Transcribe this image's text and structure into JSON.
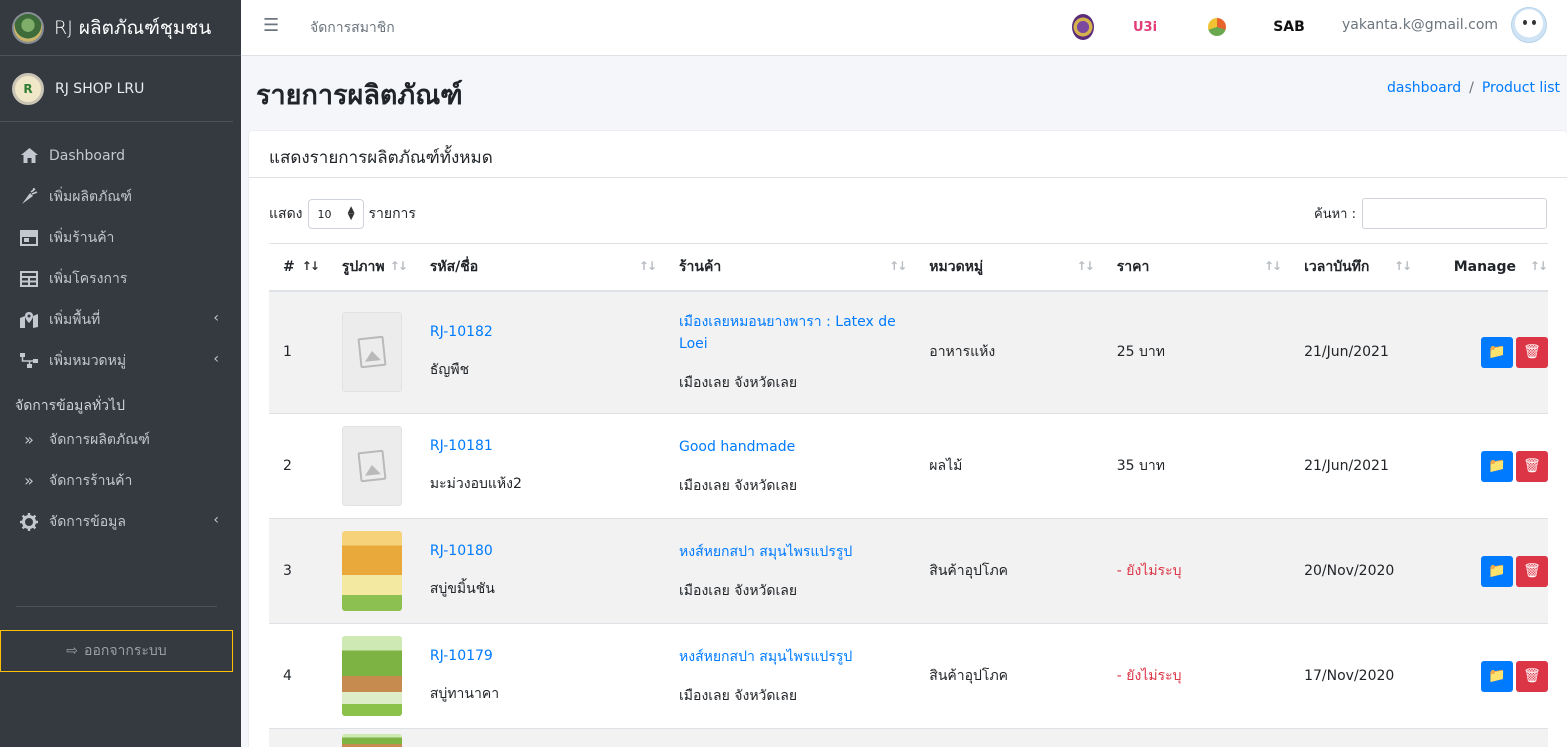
{
  "sidebar": {
    "brand": "RJ ผลิตภัณฑ์ชุมชน",
    "user": "RJ SHOP LRU",
    "user_avatar_letter": "R",
    "menu": [
      {
        "label": "Dashboard",
        "icon": "home-icon"
      },
      {
        "label": "เพิ่มผลิตภัณฑ์",
        "icon": "carrot-icon"
      },
      {
        "label": "เพิ่มร้านค้า",
        "icon": "store-icon"
      },
      {
        "label": "เพิ่มโครงการ",
        "icon": "table-icon"
      },
      {
        "label": "เพิ่มพื้นที่",
        "icon": "map-marked-icon"
      },
      {
        "label": "เพิ่มหมวดหมู่",
        "icon": "sitemap-icon"
      }
    ],
    "section_header": "จัดการข้อมูลทั่วไป",
    "manage_menu": [
      {
        "label": "จัดการผลิตภัณฑ์",
        "icon": "angle-double-right-icon"
      },
      {
        "label": "จัดการร้านค้า",
        "icon": "angle-double-right-icon"
      },
      {
        "label": "จัดการข้อมูล",
        "icon": "gear-icon"
      }
    ],
    "logout": "ออกจากระบบ"
  },
  "topbar": {
    "title": "จัดการสมาชิก",
    "partner_logo_text": "U3i",
    "partner_logo_text_2": "SAB",
    "email": "yakanta.k@gmail.com"
  },
  "page": {
    "title": "รายการผลิตภัณฑ์",
    "breadcrumb": [
      "dashboard",
      "Product list"
    ]
  },
  "card": {
    "header": "แสดงรายการผลิตภัณฑ์ทั้งหมด",
    "show_label": "แสดง",
    "page_size": "10",
    "entries_label": "รายการ",
    "search_label": "ค้นหา :"
  },
  "table": {
    "columns": [
      "#",
      "รูปภาพ",
      "รหัส/ชื่อ",
      "ร้านค้า",
      "หมวดหมู่",
      "ราคา",
      "เวลาบันทึก",
      "Manage"
    ],
    "rows": [
      {
        "num": "1",
        "image": "placeholder",
        "code": "RJ-10182",
        "name": "ธัญพืช",
        "shop": "เมืองเลยหมอนยางพารา : Latex de Loei",
        "location": "เมืองเลย จังหวัดเลย",
        "category": "อาหารแห้ง",
        "price": "25 บาท",
        "date": "21/Jun/2021"
      },
      {
        "num": "2",
        "image": "placeholder",
        "code": "RJ-10181",
        "name": "มะม่วงอบแห้ง2",
        "shop": "Good handmade",
        "location": "เมืองเลย จังหวัดเลย",
        "category": "ผลไม้",
        "price": "35 บาท",
        "date": "21/Jun/2021"
      },
      {
        "num": "3",
        "image": "poster-orange",
        "code": "RJ-10180",
        "name": "สบู่ขมิ้นชัน",
        "shop": "หงส์หยกสปา สมุนไพรแปรรูป",
        "location": "เมืองเลย จังหวัดเลย",
        "category": "สินค้าอุปโภค",
        "price": "- ยังไม่ระบุ",
        "date": "20/Nov/2020"
      },
      {
        "num": "4",
        "image": "poster-green",
        "code": "RJ-10179",
        "name": "สบู่ทานาคา",
        "shop": "หงส์หยกสปา สมุนไพรแปรรูป",
        "location": "เมืองเลย จังหวัดเลย",
        "category": "สินค้าอุปโภค",
        "price": "- ยังไม่ระบุ",
        "date": "17/Nov/2020"
      }
    ]
  },
  "colors": {
    "sidebar_bg": "#343a40",
    "primary": "#007bff",
    "danger": "#dc3545",
    "logout_border": "#ffc107"
  }
}
